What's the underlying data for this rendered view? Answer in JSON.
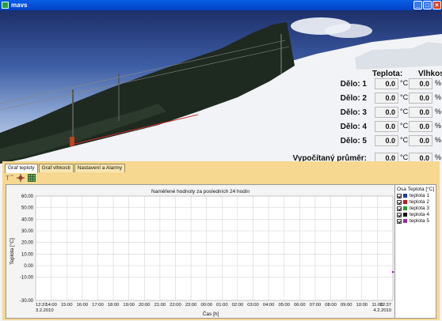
{
  "window": {
    "title": "mavs",
    "buttons": [
      "_",
      "□",
      "×"
    ]
  },
  "readout": {
    "teplota_header": "Teplota:",
    "vlhkost_header": "Vlhkost:",
    "rows": [
      {
        "label": "Dělo: 1",
        "teplota": "0.0",
        "vlhkost": "0.0"
      },
      {
        "label": "Dělo: 2",
        "teplota": "0.0",
        "vlhkost": "0.0"
      },
      {
        "label": "Dělo: 3",
        "teplota": "0.0",
        "vlhkost": "0.0"
      },
      {
        "label": "Dělo: 4",
        "teplota": "0.0",
        "vlhkost": "0.0"
      },
      {
        "label": "Dělo: 5",
        "teplota": "0.0",
        "vlhkost": "0.0"
      },
      {
        "label": "Vypočítaný průměr:",
        "teplota": "0.0",
        "vlhkost": "0.0"
      }
    ],
    "unit_temp": "°C",
    "unit_hum": "%"
  },
  "tabs": [
    {
      "label": "Graf teploty",
      "active": true
    },
    {
      "label": "Graf vlhkosti",
      "active": false
    },
    {
      "label": "Nastavení a Alarmy",
      "active": false
    }
  ],
  "toolbar_icons": [
    "pointer-text-icon",
    "pan-crosshair-icon",
    "grid-icon"
  ],
  "legend": {
    "title": "Osa Teplota [°C]",
    "items": [
      {
        "label": "teplota 1",
        "color": "#1a3ea8"
      },
      {
        "label": "teplota 2",
        "color": "#c0161b"
      },
      {
        "label": "teplota 3",
        "color": "#2c9a2c"
      },
      {
        "label": "teplota 4",
        "color": "#111111"
      },
      {
        "label": "teplota 5",
        "color": "#a02aa0"
      }
    ]
  },
  "chart_data": {
    "type": "line",
    "title": "Naměřené hodnoty za posledních 24 hodin",
    "xlabel": "Čas [h]",
    "ylabel": "Teplota [°C]",
    "ylim": [
      -30,
      60
    ],
    "y_ticks": [
      "60.00",
      "50.00",
      "40.00",
      "30.00",
      "20.00",
      "10.00",
      "0.00",
      "-10.00",
      "-30.00"
    ],
    "y_tick_values": [
      60,
      50,
      40,
      30,
      20,
      10,
      0,
      -10,
      -30
    ],
    "x_ticks": [
      "12:37",
      "14:00",
      "15:00",
      "16:00",
      "17:00",
      "18:00",
      "19:00",
      "20:00",
      "21:00",
      "22:00",
      "23:00",
      "00:00",
      "01:00",
      "02:00",
      "03:00",
      "04:00",
      "05:00",
      "06:00",
      "07:00",
      "08:00",
      "09:00",
      "10:00",
      "11:00",
      "12:37"
    ],
    "x_start_date": "3.2.2010",
    "x_end_date": "4.2.2010",
    "grid": true,
    "series": [
      {
        "name": "teplota 1",
        "values": []
      },
      {
        "name": "teplota 2",
        "values": []
      },
      {
        "name": "teplota 3",
        "values": []
      },
      {
        "name": "teplota 4",
        "values": []
      },
      {
        "name": "teplota 5",
        "values": []
      }
    ]
  }
}
